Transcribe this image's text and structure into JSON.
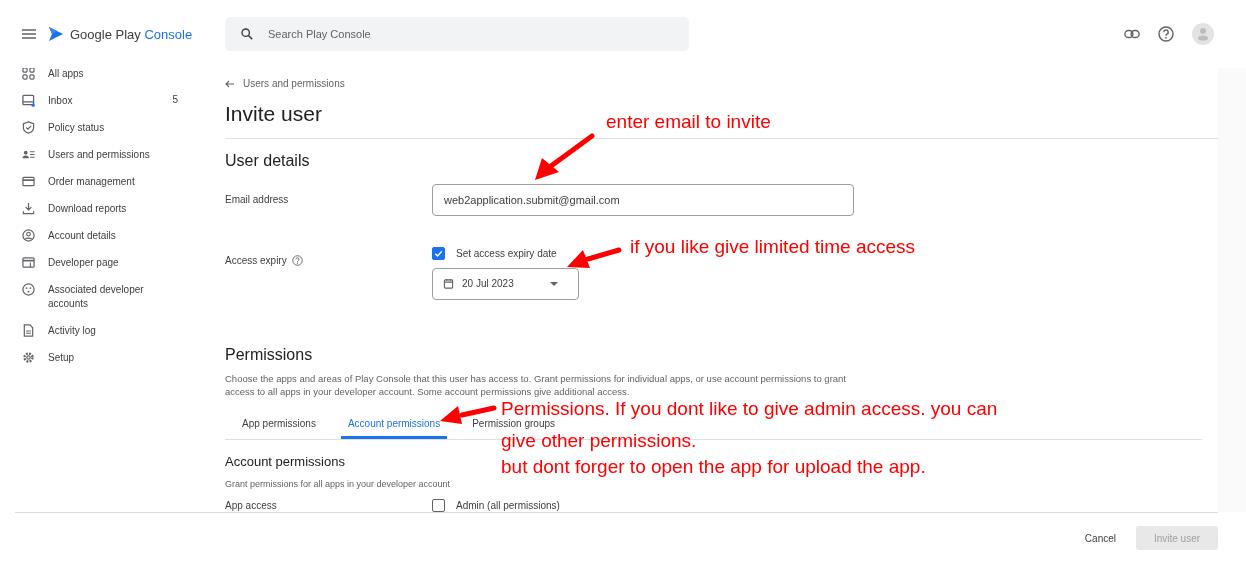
{
  "header": {
    "brand_main": "Google Play",
    "brand_accent": "Console",
    "search": {
      "placeholder": "Search Play Console"
    }
  },
  "sidebar": {
    "items": [
      {
        "label": "All apps",
        "selected": false
      },
      {
        "label": "Inbox",
        "count": "5",
        "unread": true,
        "selected": false
      },
      {
        "label": "Policy status",
        "selected": false
      },
      {
        "label": "Users and permissions",
        "selected": false
      },
      {
        "label": "Order management",
        "selected": false
      },
      {
        "label": "Download reports",
        "selected": false
      },
      {
        "label": "Account details",
        "selected": false
      },
      {
        "label": "Developer page",
        "selected": false
      },
      {
        "label": "Associated developer accounts",
        "selected": false
      },
      {
        "label": "Activity log",
        "selected": false
      },
      {
        "label": "Setup",
        "selected": false
      }
    ]
  },
  "breadcrumb": "Users and permissions",
  "title": "Invite user",
  "user_details": {
    "heading": "User details",
    "email_label": "Email address",
    "email_value": "web2application.submit@gmail.com",
    "expiry_label": "Access expiry",
    "expiry_checkbox": {
      "label": "Set access expiry date",
      "checked": true
    },
    "expiry_date": "20 Jul 2023"
  },
  "permissions": {
    "heading": "Permissions",
    "description": "Choose the apps and areas of Play Console that this user has access to. Grant permissions for individual apps, or use account permissions to grant access to all apps in your developer account. Some account permissions give additional access.",
    "tabs": [
      {
        "label": "App permissions",
        "selected": false
      },
      {
        "label": "Account permissions",
        "selected": true
      },
      {
        "label": "Permission groups",
        "selected": false
      }
    ],
    "section_heading": "Account permissions",
    "section_note": "Grant permissions for all apps in your developer account",
    "rows": [
      {
        "label": "App access",
        "option": "Admin (all permissions)",
        "checked": false
      }
    ]
  },
  "footer": {
    "buttons": [
      {
        "label": "Cancel",
        "disabled": false,
        "kind": "text"
      },
      {
        "label": "Invite user",
        "disabled": true,
        "kind": "filled"
      }
    ]
  },
  "annotations": [
    {
      "lines": [
        "enter email to invite"
      ]
    },
    {
      "lines": [
        "if you like give limited time access"
      ]
    },
    {
      "lines": [
        "Permissions. If you dont like to give admin access. you can",
        "give other permissions.",
        "but dont forger to open the app for upload the app."
      ]
    }
  ]
}
